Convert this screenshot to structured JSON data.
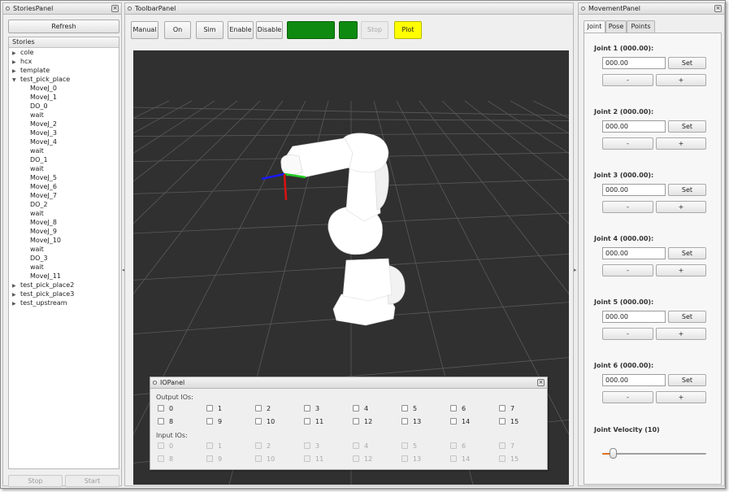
{
  "stories_panel": {
    "title": "StoriesPanel",
    "refresh_label": "Refresh",
    "tree_header": "Stories",
    "items": [
      {
        "label": "cole",
        "level": 0,
        "arrow": "▶"
      },
      {
        "label": "hcx",
        "level": 0,
        "arrow": "▶"
      },
      {
        "label": "template",
        "level": 0,
        "arrow": "▶"
      },
      {
        "label": "test_pick_place",
        "level": 0,
        "arrow": "▼"
      },
      {
        "label": "MoveJ_0",
        "level": 1
      },
      {
        "label": "MoveJ_1",
        "level": 1
      },
      {
        "label": "DO_0",
        "level": 1
      },
      {
        "label": "wait",
        "level": 1
      },
      {
        "label": "MoveJ_2",
        "level": 1
      },
      {
        "label": "MoveJ_3",
        "level": 1
      },
      {
        "label": "MoveJ_4",
        "level": 1
      },
      {
        "label": "wait",
        "level": 1
      },
      {
        "label": "DO_1",
        "level": 1
      },
      {
        "label": "wait",
        "level": 1
      },
      {
        "label": "MoveJ_5",
        "level": 1
      },
      {
        "label": "MoveJ_6",
        "level": 1
      },
      {
        "label": "MoveJ_7",
        "level": 1
      },
      {
        "label": "DO_2",
        "level": 1
      },
      {
        "label": "wait",
        "level": 1
      },
      {
        "label": "MoveJ_8",
        "level": 1
      },
      {
        "label": "MoveJ_9",
        "level": 1
      },
      {
        "label": "MoveJ_10",
        "level": 1
      },
      {
        "label": "wait",
        "level": 1
      },
      {
        "label": "DO_3",
        "level": 1
      },
      {
        "label": "wait",
        "level": 1
      },
      {
        "label": "MoveJ_11",
        "level": 1
      },
      {
        "label": "test_pick_place2",
        "level": 0,
        "arrow": "▶"
      },
      {
        "label": "test_pick_place3",
        "level": 0,
        "arrow": "▶"
      },
      {
        "label": "test_upstream",
        "level": 0,
        "arrow": "▶"
      }
    ],
    "stop_label": "Stop",
    "start_label": "Start"
  },
  "toolbar_panel": {
    "title": "ToolbarPanel",
    "buttons": {
      "manual": "Manual",
      "on": "On",
      "sim": "Sim",
      "enable": "Enable",
      "disable": "Disable",
      "stop": "Stop",
      "plot": "Plot"
    },
    "colors": {
      "status_green": "#0f8a10",
      "plot_yellow": "#ffff00",
      "viewport_bg": "#303030"
    }
  },
  "io_panel": {
    "title": "IOPanel",
    "output_label": "Output IOs:",
    "input_label": "Input IOs:",
    "outputs": [
      "0",
      "1",
      "2",
      "3",
      "4",
      "5",
      "6",
      "7",
      "8",
      "9",
      "10",
      "11",
      "12",
      "13",
      "14",
      "15"
    ],
    "inputs": [
      "0",
      "1",
      "2",
      "3",
      "4",
      "5",
      "6",
      "7",
      "8",
      "9",
      "10",
      "11",
      "12",
      "13",
      "14",
      "15"
    ]
  },
  "movement_panel": {
    "title": "MovementPanel",
    "tabs": [
      "Joint",
      "Pose",
      "Points"
    ],
    "joints": [
      {
        "label": "Joint 1 (000.00):",
        "value": "000.00"
      },
      {
        "label": "Joint 2 (000.00):",
        "value": "000.00"
      },
      {
        "label": "Joint 3 (000.00):",
        "value": "000.00"
      },
      {
        "label": "Joint 4 (000.00):",
        "value": "000.00"
      },
      {
        "label": "Joint 5 (000.00):",
        "value": "000.00"
      },
      {
        "label": "Joint 6 (000.00):",
        "value": "000.00"
      }
    ],
    "set_label": "Set",
    "minus_label": "-",
    "plus_label": "+",
    "velocity_label": "Joint Velocity (10)",
    "velocity_fraction": 0.1,
    "slider_accent": "#e07020"
  }
}
